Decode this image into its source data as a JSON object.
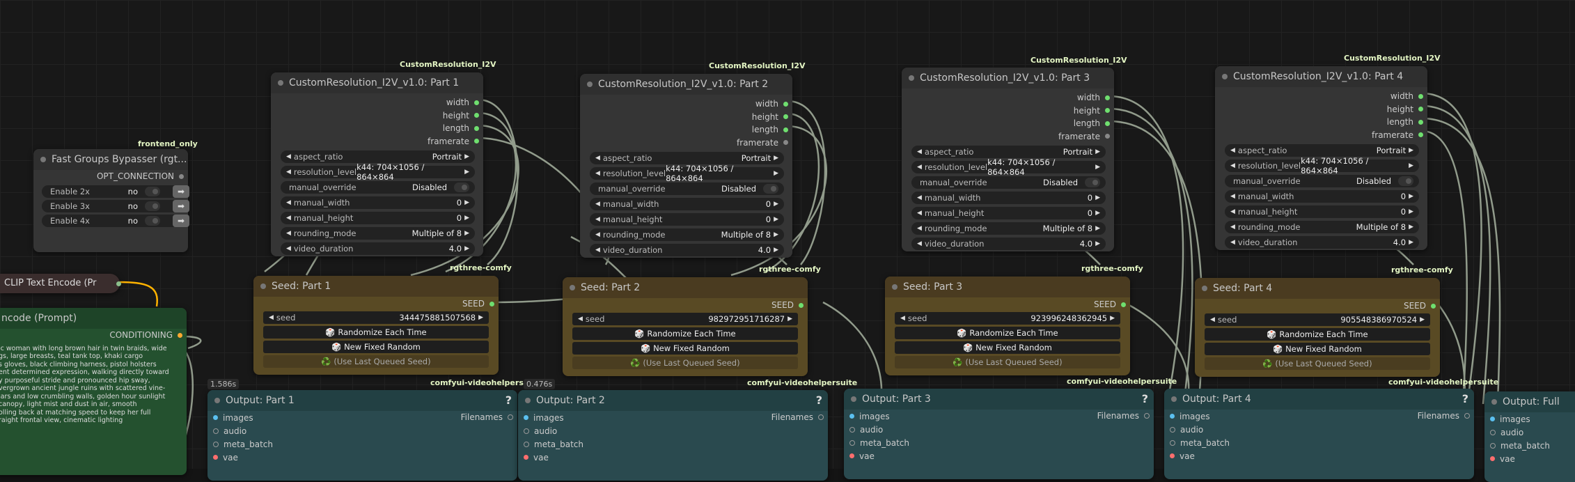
{
  "nodes": {
    "bypasser": {
      "tag": "frontend_only",
      "title": "Fast Groups Bypasser (rgt...",
      "output": "OPT_CONNECTION",
      "rows": [
        {
          "label": "Enable 2x",
          "value": "no"
        },
        {
          "label": "Enable 3x",
          "value": "no"
        },
        {
          "label": "Enable 4x",
          "value": "no"
        }
      ]
    },
    "clip_text_encode": {
      "title": "CLIP Text Encode (Pr"
    },
    "encode_prompt": {
      "title": "ncode (Prompt)",
      "output": "CONDITIONING",
      "text": "ic woman with long brown hair in twin braids, wide\ngs, large breasts, teal tank top, khaki cargo\ns gloves, black climbing harness, pistol holsters\nent determined expression, walking directly toward\ny purposeful stride and pronounced hip sway,\nvergrown ancient jungle ruins with scattered vine-\nlars and low crumbling walls, golden hour sunlight\n canopy, light mist and dust in air, smooth\nolling back at matching speed to keep her full\nraight frontal view, cinematic lighting"
    },
    "res": [
      {
        "tag": "CustomResolution_I2V",
        "title": "CustomResolution_I2V_v1.0: Part 1",
        "outputs": [
          "width",
          "height",
          "length",
          "framerate"
        ],
        "widgets": [
          {
            "label": "aspect_ratio",
            "value": "Portrait"
          },
          {
            "label": "resolution_level",
            "value": "k44: 704×1056 / 864×864"
          },
          {
            "label": "manual_override",
            "value": "Disabled"
          },
          {
            "label": "manual_width",
            "value": "0"
          },
          {
            "label": "manual_height",
            "value": "0"
          },
          {
            "label": "rounding_mode",
            "value": "Multiple of 8"
          },
          {
            "label": "video_duration",
            "value": "4.0"
          }
        ]
      },
      {
        "tag": "CustomResolution_I2V",
        "title": "CustomResolution_I2V_v1.0: Part 2",
        "outputs": [
          "width",
          "height",
          "length",
          "framerate"
        ],
        "widgets": [
          {
            "label": "aspect_ratio",
            "value": "Portrait"
          },
          {
            "label": "resolution_level",
            "value": "k44: 704×1056 / 864×864"
          },
          {
            "label": "manual_override",
            "value": "Disabled"
          },
          {
            "label": "manual_width",
            "value": "0"
          },
          {
            "label": "manual_height",
            "value": "0"
          },
          {
            "label": "rounding_mode",
            "value": "Multiple of 8"
          },
          {
            "label": "video_duration",
            "value": "4.0"
          }
        ]
      },
      {
        "tag": "CustomResolution_I2V",
        "title": "CustomResolution_I2V_v1.0: Part 3",
        "outputs": [
          "width",
          "height",
          "length",
          "framerate"
        ],
        "widgets": [
          {
            "label": "aspect_ratio",
            "value": "Portrait"
          },
          {
            "label": "resolution_level",
            "value": "k44: 704×1056 / 864×864"
          },
          {
            "label": "manual_override",
            "value": "Disabled"
          },
          {
            "label": "manual_width",
            "value": "0"
          },
          {
            "label": "manual_height",
            "value": "0"
          },
          {
            "label": "rounding_mode",
            "value": "Multiple of 8"
          },
          {
            "label": "video_duration",
            "value": "4.0"
          }
        ]
      },
      {
        "tag": "CustomResolution_I2V",
        "title": "CustomResolution_I2V_v1.0: Part 4",
        "outputs": [
          "width",
          "height",
          "length",
          "framerate"
        ],
        "widgets": [
          {
            "label": "aspect_ratio",
            "value": "Portrait"
          },
          {
            "label": "resolution_level",
            "value": "k44: 704×1056 / 864×864"
          },
          {
            "label": "manual_override",
            "value": "Disabled"
          },
          {
            "label": "manual_width",
            "value": "0"
          },
          {
            "label": "manual_height",
            "value": "0"
          },
          {
            "label": "rounding_mode",
            "value": "Multiple of 8"
          },
          {
            "label": "video_duration",
            "value": "4.0"
          }
        ]
      }
    ],
    "seed": [
      {
        "tag": "rgthree-comfy",
        "title": "Seed: Part 1",
        "output": "SEED",
        "seed_label": "seed",
        "seed_value": "344475881507568",
        "randomize": "🎲 Randomize Each Time",
        "new_fixed": "🎲 New Fixed Random",
        "last_queued": "♻️ (Use Last Queued Seed)"
      },
      {
        "tag": "rgthree-comfy",
        "title": "Seed: Part 2",
        "output": "SEED",
        "seed_label": "seed",
        "seed_value": "982972951716287",
        "randomize": "🎲 Randomize Each Time",
        "new_fixed": "🎲 New Fixed Random",
        "last_queued": "♻️ (Use Last Queued Seed)"
      },
      {
        "tag": "rgthree-comfy",
        "title": "Seed: Part 3",
        "output": "SEED",
        "seed_label": "seed",
        "seed_value": "923996248362945",
        "randomize": "🎲 Randomize Each Time",
        "new_fixed": "🎲 New Fixed Random",
        "last_queued": "♻️ (Use Last Queued Seed)"
      },
      {
        "tag": "rgthree-comfy",
        "title": "Seed: Part 4",
        "output": "SEED",
        "seed_label": "seed",
        "seed_value": "905548386970524",
        "randomize": "🎲 Randomize Each Time",
        "new_fixed": "🎲 New Fixed Random",
        "last_queued": "♻️ (Use Last Queued Seed)"
      }
    ],
    "out": [
      {
        "tag": "comfyui-videohelpersuite",
        "badge": "1.586s",
        "title": "Output: Part 1",
        "help": "?",
        "output": "Filenames",
        "inputs": [
          "images",
          "audio",
          "meta_batch",
          "vae"
        ]
      },
      {
        "tag": "comfyui-videohelpersuite",
        "badge": "0.476s",
        "title": "Output: Part 2",
        "help": "?",
        "output": "Filenames",
        "inputs": [
          "images",
          "audio",
          "meta_batch",
          "vae"
        ]
      },
      {
        "tag": "comfyui-videohelpersuite",
        "badge": "",
        "title": "Output: Part 3",
        "help": "?",
        "output": "Filenames",
        "inputs": [
          "images",
          "audio",
          "meta_batch",
          "vae"
        ]
      },
      {
        "tag": "comfyui-videohelpersuite",
        "badge": "",
        "title": "Output: Part 4",
        "help": "?",
        "output": "Filenames",
        "inputs": [
          "images",
          "audio",
          "meta_batch",
          "vae"
        ]
      },
      {
        "tag": "",
        "badge": "",
        "title": "Output: Full",
        "help": "",
        "output": "",
        "inputs": [
          "images",
          "audio",
          "meta_batch",
          "vae"
        ]
      }
    ]
  },
  "colors": {
    "canvas": "#181818",
    "node_gray": "#353535",
    "node_brown": "#594a24",
    "node_teal": "#2a4a4f",
    "node_green": "#24512f",
    "socket_green": "#6fdf6f",
    "socket_orange": "#ffa931",
    "socket_blue": "#5bc0f0",
    "socket_pink": "#ff6e6e",
    "tag_text": "#e4f6c4"
  },
  "icons": {
    "collapse": "dot",
    "arrows": "triangle-left-right",
    "run": "arrow-right-icon"
  }
}
